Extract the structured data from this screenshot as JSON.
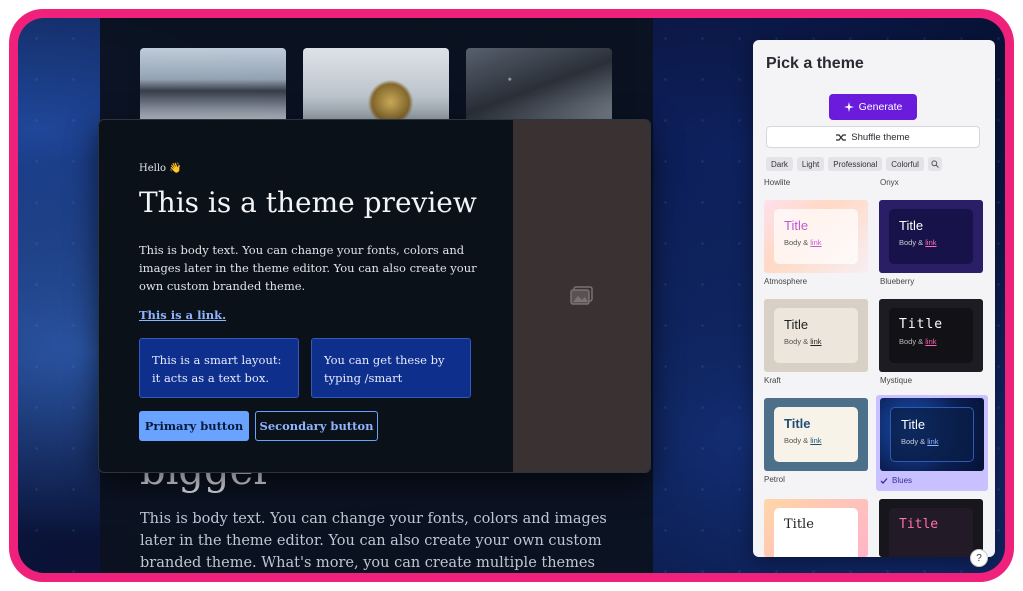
{
  "preview": {
    "hello": "Hello 👋",
    "title": "This is a theme preview",
    "body": "This is body text. You can change your fonts, colors and images later in the theme editor. You can also create your own custom branded theme.",
    "link": "This is a link.",
    "smart1": "This is a smart layout: it acts as a text box.",
    "smart2": "You can get these by typing /smart",
    "primary_button": "Primary button",
    "secondary_button": "Secondary button",
    "image_icon": "image-placeholder-icon"
  },
  "background_doc": {
    "heading": "bigger",
    "body": "This is body text. You can change your fonts, colors and images later in the theme editor. You can also create your own custom branded theme. What's more, you can create multiple themes and"
  },
  "panel": {
    "title": "Pick a theme",
    "generate_label": "Generate",
    "shuffle_label": "Shuffle theme",
    "filters": [
      "Dark",
      "Light",
      "Professional",
      "Colorful"
    ],
    "themes": [
      {
        "name": "Howlite"
      },
      {
        "name": "Onyx"
      },
      {
        "name": "Atmosphere",
        "title": "Title",
        "body": "Body & ",
        "link": "link"
      },
      {
        "name": "Blueberry",
        "title": "Title",
        "body": "Body & ",
        "link": "link"
      },
      {
        "name": "Kraft",
        "title": "Title",
        "body": "Body & ",
        "link": "link"
      },
      {
        "name": "Mystique",
        "title": "Title",
        "body": "Body & ",
        "link": "link"
      },
      {
        "name": "Petrol",
        "title": "Title",
        "body": "Body & ",
        "link": "link"
      },
      {
        "name": "Blues",
        "title": "Title",
        "body": "Body & ",
        "link": "link",
        "selected": true
      },
      {
        "title": "Title"
      },
      {
        "title": "Title"
      }
    ],
    "accent": "#6a1bdb"
  },
  "help_label": "?"
}
